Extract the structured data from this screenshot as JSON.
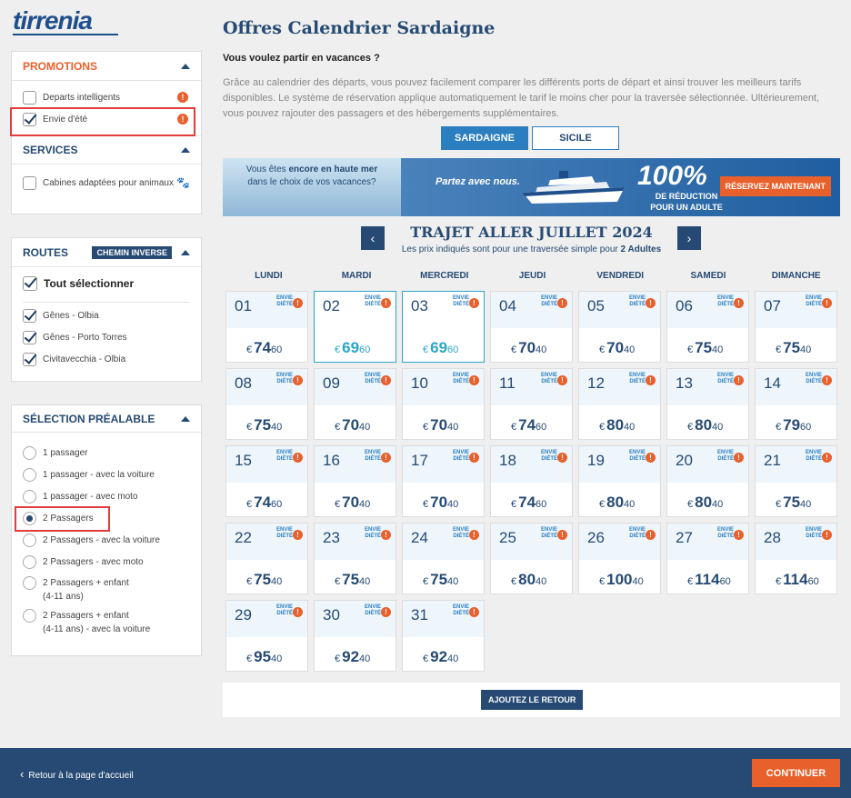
{
  "brand": {
    "logo_text": "tirrenia"
  },
  "sidebar": {
    "promotions": {
      "title": "PROMOTIONS",
      "items": [
        {
          "label": "Departs intelligents",
          "checked": false
        },
        {
          "label": "Envie d'été",
          "checked": true
        }
      ]
    },
    "services": {
      "title": "SERVICES",
      "items": [
        {
          "label": "Cabines adaptées pour animaux",
          "checked": false
        }
      ]
    },
    "routes": {
      "title": "ROUTES",
      "badge": "CHEMIN INVERSE",
      "select_all": "Tout sélectionner",
      "items": [
        {
          "label": "Gênes - Olbia",
          "checked": true
        },
        {
          "label": "Gênes - Porto Torres",
          "checked": true
        },
        {
          "label": "Civitavecchia - Olbia",
          "checked": true
        }
      ]
    },
    "preselection": {
      "title": "SÉLECTION PRÉALABLE",
      "options": [
        {
          "label": "1 passager",
          "selected": false
        },
        {
          "label": "1 passager - avec la voiture",
          "selected": false
        },
        {
          "label": "1 passager - avec moto",
          "selected": false
        },
        {
          "label": "2 Passagers",
          "selected": true
        },
        {
          "label": "2 Passagers - avec la voiture",
          "selected": false
        },
        {
          "label": "2 Passagers - avec moto",
          "selected": false
        },
        {
          "label": "2 Passagers + enfant",
          "label2": "(4-11 ans)",
          "selected": false
        },
        {
          "label": "2 Passagers + enfant",
          "label2": "(4-11 ans) - avec la voiture",
          "selected": false
        }
      ]
    }
  },
  "main": {
    "title": "Offres Calendrier Sardaigne",
    "subtitle": "Vous voulez partir en vacances ?",
    "description": "Grâce au calendrier des départs, vous pouvez facilement comparer les différents ports de départ et ainsi trouver les meilleurs tarifs disponibles. Le système de réservation applique automatiquement le tarif le moins cher pour la traversée sélectionnée. Ultérieurement, vous pouvez rajouter des passagers et des hébergements supplémentaires.",
    "tabs": [
      {
        "label": "SARDAIGNE",
        "active": true
      },
      {
        "label": "SICILE",
        "active": false
      }
    ],
    "banner": {
      "left_text_a": "Vous êtes ",
      "left_text_b": "encore en haute mer",
      "left_text_c": "dans le choix de vos vacances?",
      "partez": "Partez avec nous.",
      "percent": "100%",
      "reduction_1": "DE RÉDUCTION",
      "reduction_2": "POUR UN ADULTE",
      "cta": "RÉSERVEZ MAINTENANT"
    },
    "month_title": "TRAJET ALLER JUILLET 2024",
    "month_note_a": "Les prix indiqués sont pour une traversée simple pour ",
    "month_note_b": "2 Adultes",
    "weekdays": [
      "LUNDI",
      "MARDI",
      "MERCREDI",
      "JEUDI",
      "VENDREDI",
      "SAMEDI",
      "DIMANCHE"
    ],
    "promo_tag_1": "ENVIE",
    "promo_tag_2": "DIÉTÉ",
    "currency": "€",
    "days": [
      {
        "day": "01",
        "euros": "74",
        "cents": "60",
        "selected": false
      },
      {
        "day": "02",
        "euros": "69",
        "cents": "60",
        "selected": true
      },
      {
        "day": "03",
        "euros": "69",
        "cents": "60",
        "selected": true
      },
      {
        "day": "04",
        "euros": "70",
        "cents": "40",
        "selected": false
      },
      {
        "day": "05",
        "euros": "70",
        "cents": "40",
        "selected": false
      },
      {
        "day": "06",
        "euros": "75",
        "cents": "40",
        "selected": false
      },
      {
        "day": "07",
        "euros": "75",
        "cents": "40",
        "selected": false
      },
      {
        "day": "08",
        "euros": "75",
        "cents": "40",
        "selected": false
      },
      {
        "day": "09",
        "euros": "70",
        "cents": "40",
        "selected": false
      },
      {
        "day": "10",
        "euros": "70",
        "cents": "40",
        "selected": false
      },
      {
        "day": "11",
        "euros": "74",
        "cents": "60",
        "selected": false
      },
      {
        "day": "12",
        "euros": "80",
        "cents": "40",
        "selected": false
      },
      {
        "day": "13",
        "euros": "80",
        "cents": "40",
        "selected": false
      },
      {
        "day": "14",
        "euros": "79",
        "cents": "60",
        "selected": false
      },
      {
        "day": "15",
        "euros": "74",
        "cents": "60",
        "selected": false
      },
      {
        "day": "16",
        "euros": "70",
        "cents": "40",
        "selected": false
      },
      {
        "day": "17",
        "euros": "70",
        "cents": "40",
        "selected": false
      },
      {
        "day": "18",
        "euros": "74",
        "cents": "60",
        "selected": false
      },
      {
        "day": "19",
        "euros": "80",
        "cents": "40",
        "selected": false
      },
      {
        "day": "20",
        "euros": "80",
        "cents": "40",
        "selected": false
      },
      {
        "day": "21",
        "euros": "75",
        "cents": "40",
        "selected": false
      },
      {
        "day": "22",
        "euros": "75",
        "cents": "40",
        "selected": false
      },
      {
        "day": "23",
        "euros": "75",
        "cents": "40",
        "selected": false
      },
      {
        "day": "24",
        "euros": "75",
        "cents": "40",
        "selected": false
      },
      {
        "day": "25",
        "euros": "80",
        "cents": "40",
        "selected": false
      },
      {
        "day": "26",
        "euros": "100",
        "cents": "40",
        "selected": false
      },
      {
        "day": "27",
        "euros": "114",
        "cents": "60",
        "selected": false
      },
      {
        "day": "28",
        "euros": "114",
        "cents": "60",
        "selected": false
      },
      {
        "day": "29",
        "euros": "95",
        "cents": "40",
        "selected": false
      },
      {
        "day": "30",
        "euros": "92",
        "cents": "40",
        "selected": false
      },
      {
        "day": "31",
        "euros": "92",
        "cents": "40",
        "selected": false
      }
    ],
    "add_return": "AJOUTEZ LE RETOUR"
  },
  "footer": {
    "back": "Retour à la page d'accueil",
    "continue": "CONTINUER"
  },
  "colors": {
    "navy": "#264a73",
    "orange": "#e8602c",
    "blue": "#2b7ec0",
    "teal": "#2aa6c6"
  }
}
